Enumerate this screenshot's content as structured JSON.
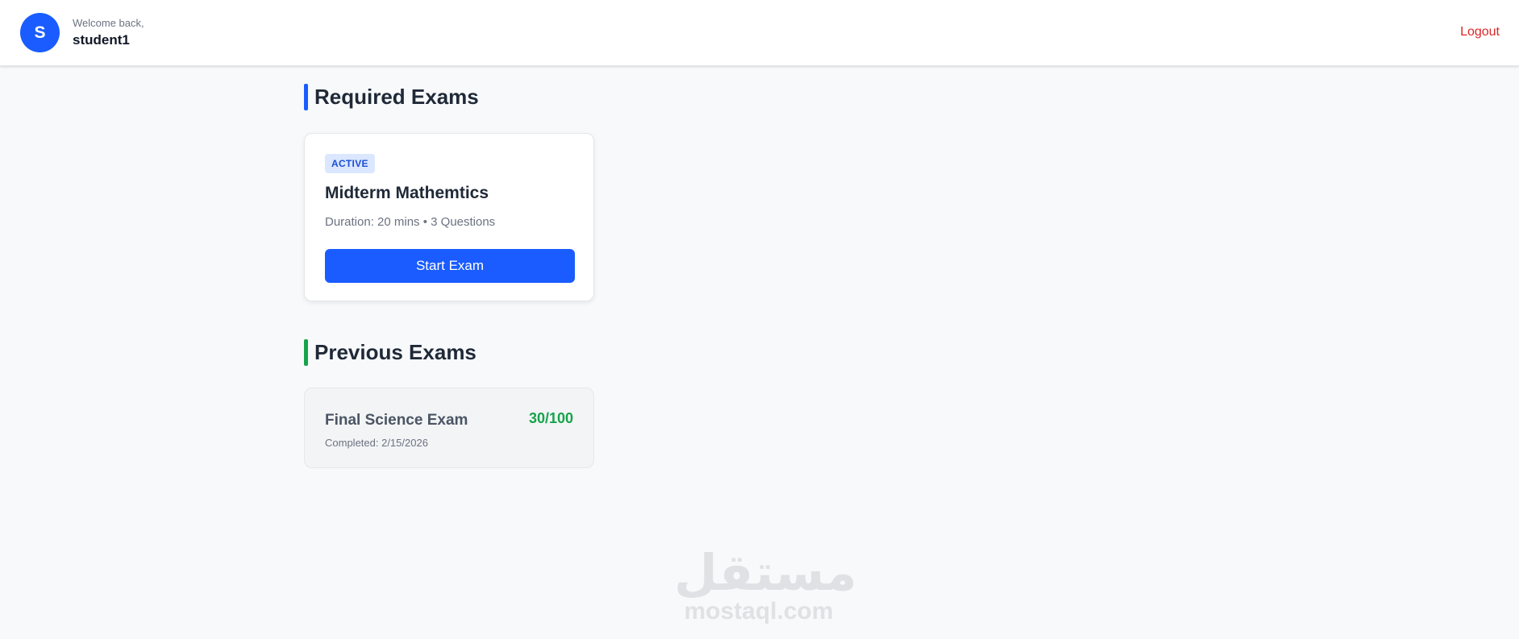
{
  "header": {
    "avatar_initial": "S",
    "welcome_text": "Welcome back,",
    "username": "student1",
    "logout_label": "Logout"
  },
  "required": {
    "title": "Required Exams",
    "exams": [
      {
        "status": "ACTIVE",
        "title": "Midterm Mathemtics",
        "meta": "Duration: 20 mins • 3 Questions",
        "button_label": "Start Exam"
      }
    ]
  },
  "previous": {
    "title": "Previous Exams",
    "exams": [
      {
        "title": "Final Science Exam",
        "completed": "Completed: 2/15/2026",
        "score": "30/100"
      }
    ]
  },
  "watermark": {
    "arabic": "مستقل",
    "latin": "mostaql.com"
  },
  "colors": {
    "primary": "#1a5cff",
    "success": "#16a34a",
    "danger": "#dc2626"
  }
}
